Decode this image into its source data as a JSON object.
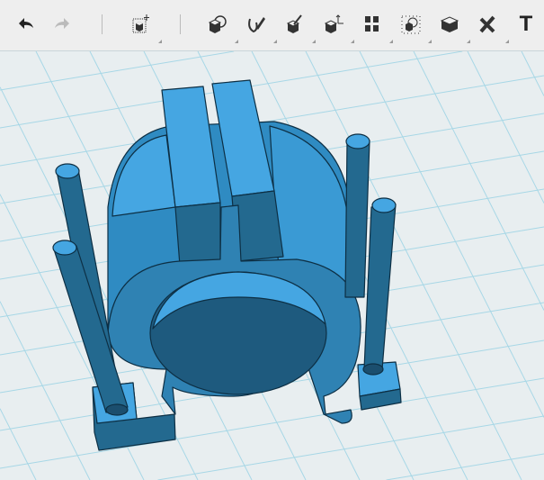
{
  "toolbar": {
    "tools": [
      {
        "name": "undo-icon"
      },
      {
        "name": "redo-icon"
      },
      {
        "name": "transform-icon"
      },
      {
        "name": "primitives-icon"
      },
      {
        "name": "sketch-icon"
      },
      {
        "name": "construct-icon"
      },
      {
        "name": "modify-icon"
      },
      {
        "name": "pattern-icon"
      },
      {
        "name": "grouping-icon"
      },
      {
        "name": "combine-icon"
      },
      {
        "name": "measure-icon"
      }
    ],
    "text_tool_label": "T"
  },
  "colors": {
    "model_face": "#45a6e2",
    "model_side": "#23698f",
    "grid": "#9fd3e4",
    "background": "#e8eef0"
  }
}
